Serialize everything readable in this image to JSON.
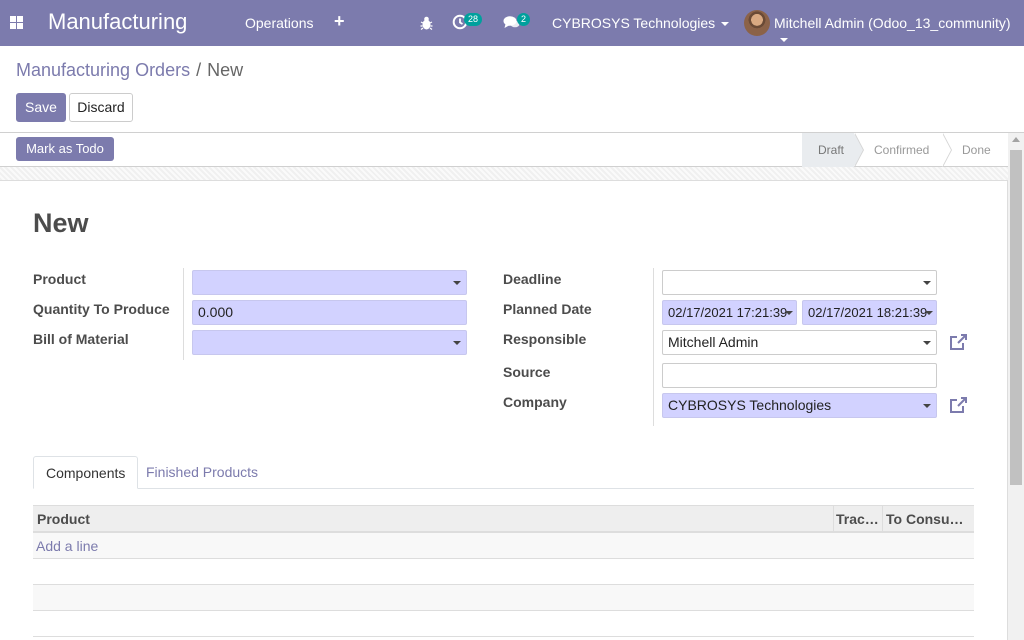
{
  "navbar": {
    "app_title": "Manufacturing",
    "menu_operations": "Operations",
    "plus_icon": "+",
    "activity_count": "28",
    "messages_count": "2",
    "company": "CYBROSYS Technologies",
    "user": "Mitchell Admin (Odoo_13_community)"
  },
  "breadcrumb": {
    "parent": "Manufacturing Orders",
    "separator": "/",
    "current": "New"
  },
  "buttons": {
    "save": "Save",
    "discard": "Discard",
    "mark_todo": "Mark as Todo"
  },
  "statusbar": {
    "stages": [
      {
        "label": "Draft",
        "active": true
      },
      {
        "label": "Confirmed",
        "active": false
      },
      {
        "label": "Done",
        "active": false
      }
    ]
  },
  "form": {
    "title": "New",
    "left": {
      "product_label": "Product",
      "product_value": "",
      "qty_label": "Quantity To Produce",
      "qty_value": "0.000",
      "bom_label": "Bill of Material",
      "bom_value": ""
    },
    "right": {
      "deadline_label": "Deadline",
      "deadline_value": "",
      "planned_label": "Planned Date",
      "planned_start": "02/17/2021 17:21:39",
      "planned_end": "02/17/2021 18:21:39",
      "responsible_label": "Responsible",
      "responsible_value": "Mitchell Admin",
      "source_label": "Source",
      "source_value": "",
      "company_label": "Company",
      "company_value": "CYBROSYS Technologies"
    }
  },
  "notebook": {
    "tabs": [
      {
        "label": "Components",
        "active": true
      },
      {
        "label": "Finished Products",
        "active": false
      }
    ],
    "columns": [
      "Product",
      "Trac…",
      "To Consum…"
    ],
    "add_line": "Add a line"
  },
  "colors": {
    "brand": "#7c7bad",
    "required_field": "#d2d2ff",
    "badge": "#00a09d"
  }
}
